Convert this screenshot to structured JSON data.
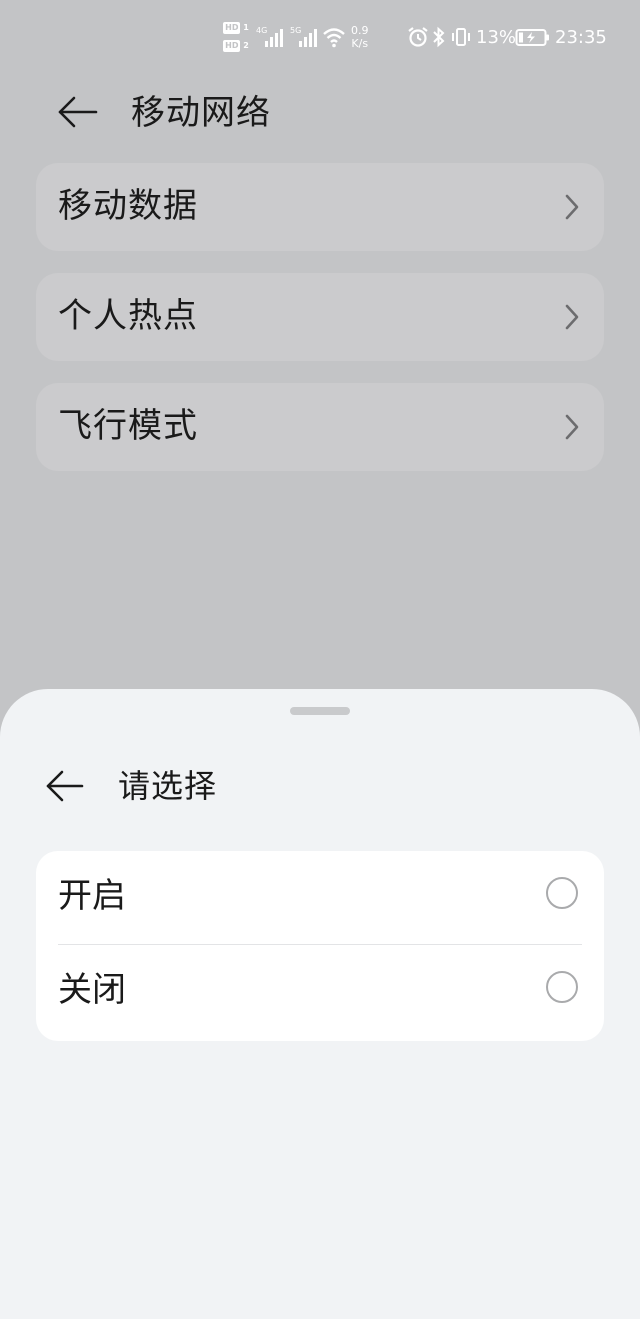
{
  "status_bar": {
    "hd1": "HD",
    "hd1_sim": "1",
    "hd2": "HD",
    "hd2_sim": "2",
    "net1": "4G",
    "net2": "5G",
    "speed_value": "0.9",
    "speed_unit": "K/s",
    "battery_percent": "13%",
    "time": "23:35"
  },
  "header": {
    "title": "移动网络"
  },
  "menu": {
    "items": [
      {
        "label": "移动数据"
      },
      {
        "label": "个人热点"
      },
      {
        "label": "飞行模式"
      }
    ]
  },
  "sheet": {
    "title": "请选择",
    "options": [
      {
        "label": "开启",
        "selected": false
      },
      {
        "label": "关闭",
        "selected": false
      }
    ]
  },
  "colors": {
    "background_dimmed": "#c3c4c6",
    "card_dimmed": "#cbcbcd",
    "sheet_bg": "#f1f3f5",
    "card_white": "#ffffff",
    "text": "#1a1a1a"
  }
}
